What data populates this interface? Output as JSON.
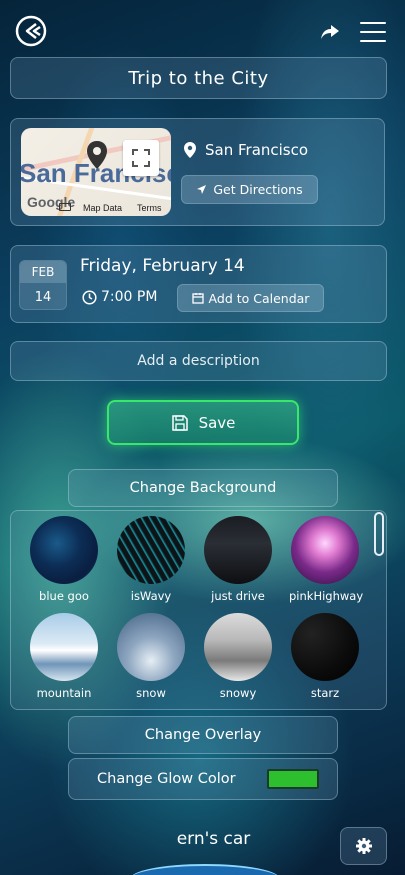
{
  "header": {
    "logo_icon": "app-logo-icon",
    "share_icon": "share-icon",
    "menu_icon": "hamburger-menu-icon"
  },
  "event": {
    "title": "Trip to the City"
  },
  "location": {
    "name": "San Francisco",
    "directions_label": "Get Directions",
    "map": {
      "city_label": "San Francisco",
      "provider": "Google",
      "map_data_label": "Map Data",
      "terms_label": "Terms"
    }
  },
  "date": {
    "month": "FEB",
    "day": "14",
    "full": "Friday, February 14",
    "time": "7:00 PM",
    "add_calendar_label": "Add to Calendar"
  },
  "description": {
    "placeholder": "Add a description"
  },
  "save_label": "Save",
  "background": {
    "change_label": "Change Background",
    "options": [
      {
        "label": "blue goo"
      },
      {
        "label": "isWavy"
      },
      {
        "label": "just drive"
      },
      {
        "label": "pinkHighway"
      },
      {
        "label": "mountain"
      },
      {
        "label": "snow"
      },
      {
        "label": "snowy"
      },
      {
        "label": "starz"
      }
    ]
  },
  "overlay": {
    "change_label": "Change Overlay"
  },
  "glow": {
    "change_label": "Change Glow Color",
    "color": "#2dbf2d"
  },
  "owner_name": "ern's car",
  "colors": {
    "accent_glow": "#39e86a"
  }
}
